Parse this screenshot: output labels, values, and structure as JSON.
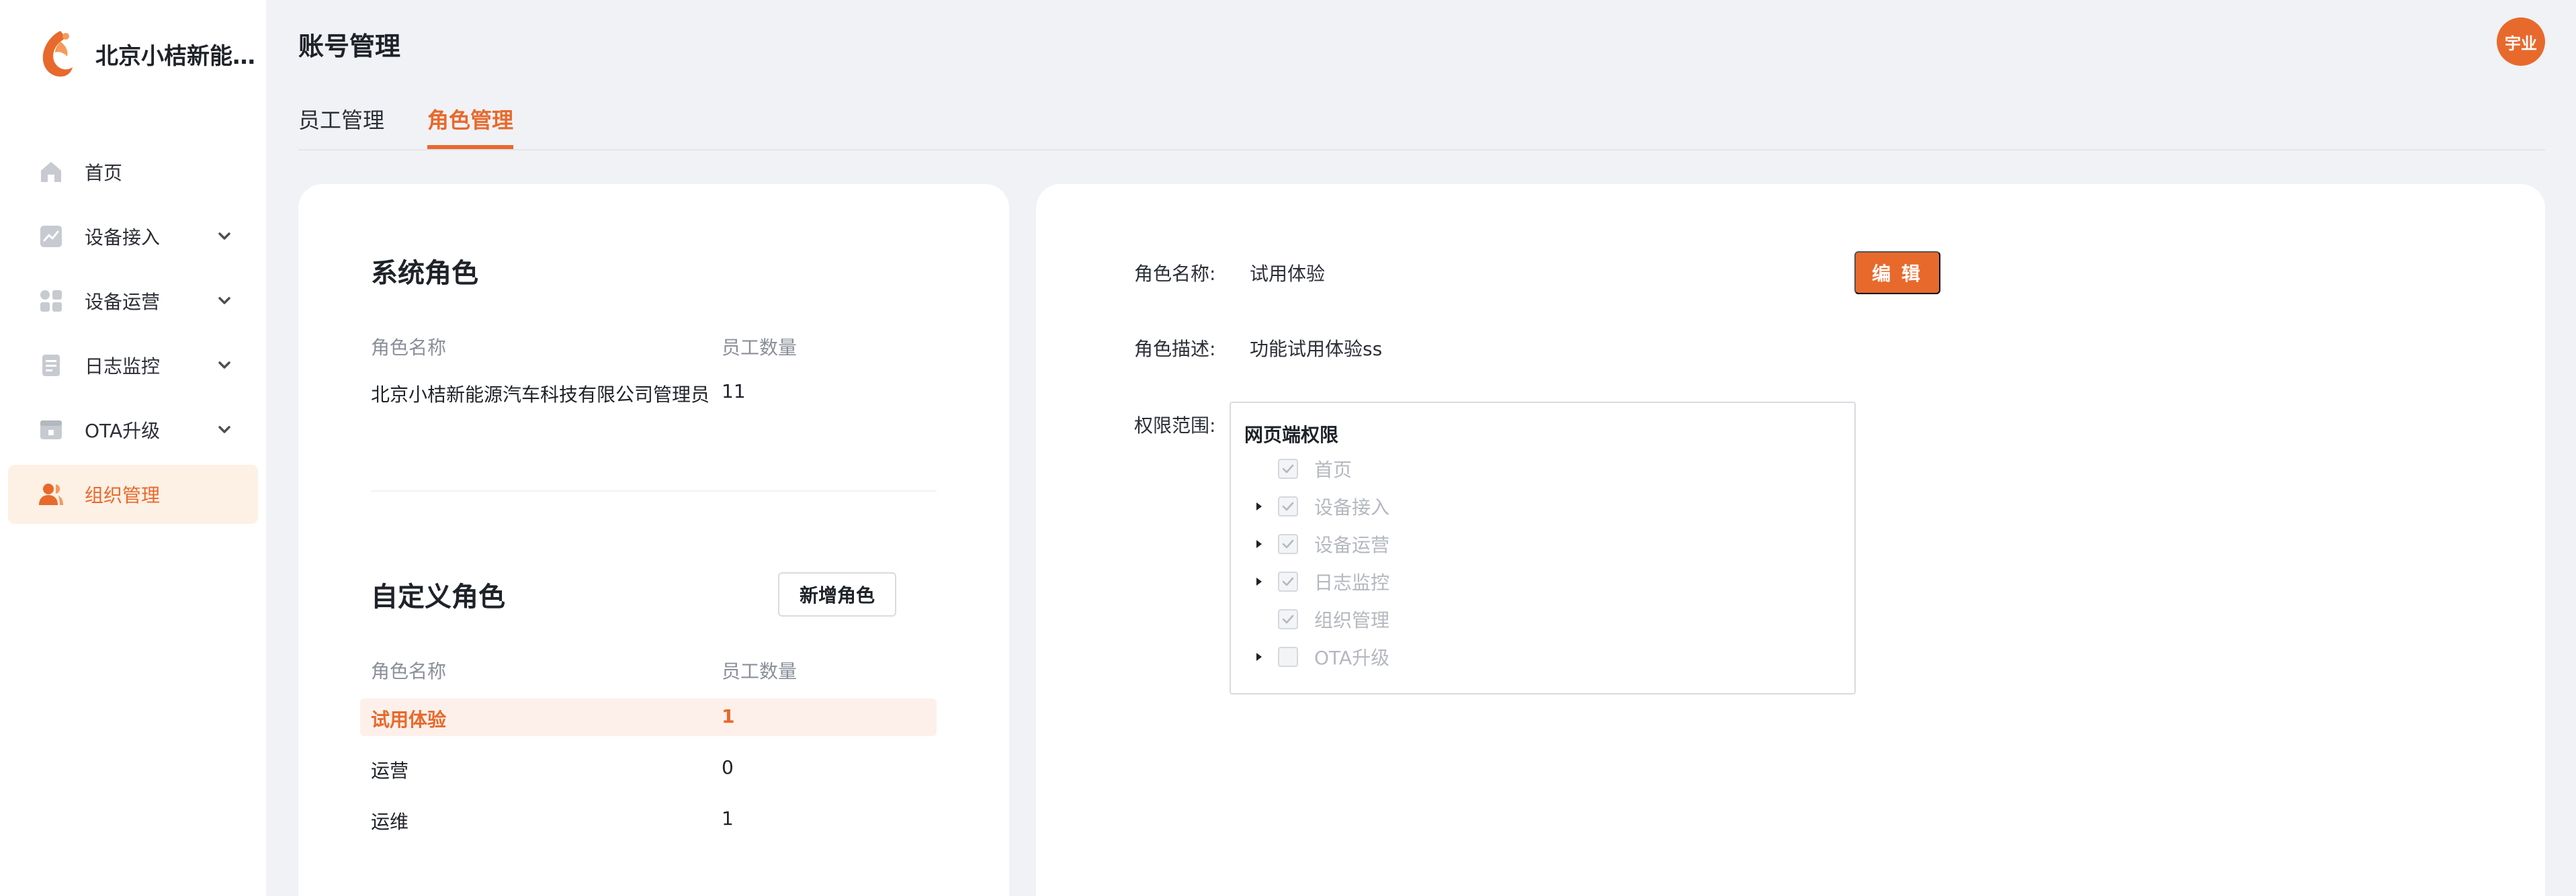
{
  "brand": {
    "name": "北京小桔新能源汽车科技有限公司"
  },
  "header": {
    "title": "账号管理",
    "avatar_text": "宇业"
  },
  "tabs": [
    {
      "label": "员工管理",
      "active": false
    },
    {
      "label": "角色管理",
      "active": true
    }
  ],
  "sidebar": {
    "items": [
      {
        "label": "首页",
        "icon": "home-icon",
        "expandable": false,
        "active": false
      },
      {
        "label": "设备接入",
        "icon": "chart-icon",
        "expandable": true,
        "active": false
      },
      {
        "label": "设备运营",
        "icon": "grid-icon",
        "expandable": true,
        "active": false
      },
      {
        "label": "日志监控",
        "icon": "document-icon",
        "expandable": true,
        "active": false
      },
      {
        "label": "OTA升级",
        "icon": "box-icon",
        "expandable": true,
        "active": false
      },
      {
        "label": "组织管理",
        "icon": "users-icon",
        "expandable": false,
        "active": true
      }
    ]
  },
  "system_roles": {
    "title": "系统角色",
    "columns": [
      "角色名称",
      "员工数量"
    ],
    "rows": [
      {
        "name": "北京小桔新能源汽车科技有限公司管理员",
        "count": "11"
      }
    ]
  },
  "custom_roles": {
    "title": "自定义角色",
    "add_button": "新增角色",
    "columns": [
      "角色名称",
      "员工数量"
    ],
    "rows": [
      {
        "name": "试用体验",
        "count": "1",
        "selected": true
      },
      {
        "name": "运营",
        "count": "0",
        "selected": false
      },
      {
        "name": "运维",
        "count": "1",
        "selected": false
      }
    ]
  },
  "detail": {
    "name_label": "角色名称:",
    "name_value": "试用体验",
    "edit_button": "编 辑",
    "desc_label": "角色描述:",
    "desc_value": "功能试用体验ss",
    "scope_label": "权限范围:",
    "tree": {
      "root": "网页端权限",
      "nodes": [
        {
          "label": "首页",
          "has_children": false,
          "checked": true
        },
        {
          "label": "设备接入",
          "has_children": true,
          "checked": true
        },
        {
          "label": "设备运营",
          "has_children": true,
          "checked": true
        },
        {
          "label": "日志监控",
          "has_children": true,
          "checked": true
        },
        {
          "label": "组织管理",
          "has_children": false,
          "checked": true
        },
        {
          "label": "OTA升级",
          "has_children": true,
          "checked": false
        }
      ]
    }
  },
  "colors": {
    "accent": "#e8692c",
    "accent_bg": "#fdf0e4",
    "page_bg": "#f1f2f6"
  }
}
